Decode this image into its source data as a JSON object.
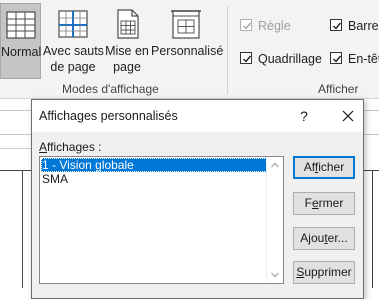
{
  "ribbon": {
    "workbook_views": {
      "buttons": [
        {
          "id": "normal",
          "label_line1": "Normal",
          "label_line2": "",
          "icon": "normal-view-icon",
          "selected": true
        },
        {
          "id": "page-break",
          "label_line1": "Avec sauts",
          "label_line2": "de page",
          "icon": "page-break-preview-icon",
          "selected": false
        },
        {
          "id": "page-layout",
          "label_line1": "Mise en",
          "label_line2": "page",
          "icon": "page-layout-icon",
          "selected": false
        },
        {
          "id": "custom",
          "label_line1": "Personnalisé",
          "label_line2": "",
          "icon": "custom-views-icon",
          "selected": false
        }
      ],
      "group_label": "Modes d'affichage"
    },
    "show": {
      "checkboxes": [
        {
          "id": "ruler",
          "label": "Règle",
          "checked": true,
          "disabled": true
        },
        {
          "id": "formula-bar",
          "label": "Barre d",
          "checked": true,
          "disabled": false
        },
        {
          "id": "gridlines",
          "label": "Quadrillage",
          "checked": true,
          "disabled": false
        },
        {
          "id": "headings",
          "label": "En-têt",
          "checked": true,
          "disabled": false
        }
      ],
      "group_label": "Afficher"
    }
  },
  "dialog": {
    "title": "Affichages personnalisés",
    "help_label": "?",
    "list_label": "Affichages :",
    "list_label_access_key": "A",
    "list_label_rest": "ffichages :",
    "items": [
      {
        "label": "1 - Vision globale",
        "selected": true
      },
      {
        "label": "SMA",
        "selected": false
      }
    ],
    "buttons": {
      "show": {
        "pre": "Af",
        "key": "f",
        "post": "icher"
      },
      "close": {
        "pre": "F",
        "key": "e",
        "post": "rmer"
      },
      "add": {
        "pre": "Ajou",
        "key": "t",
        "post": "er..."
      },
      "delete": {
        "pre": "",
        "key": "S",
        "post": "upprimer"
      }
    }
  },
  "colors": {
    "accent": "#0078d7",
    "ribbon_bg": "#f3f3f3",
    "selected_button_bg": "#c5c5c5",
    "dialog_bg": "#f0f0f0"
  }
}
